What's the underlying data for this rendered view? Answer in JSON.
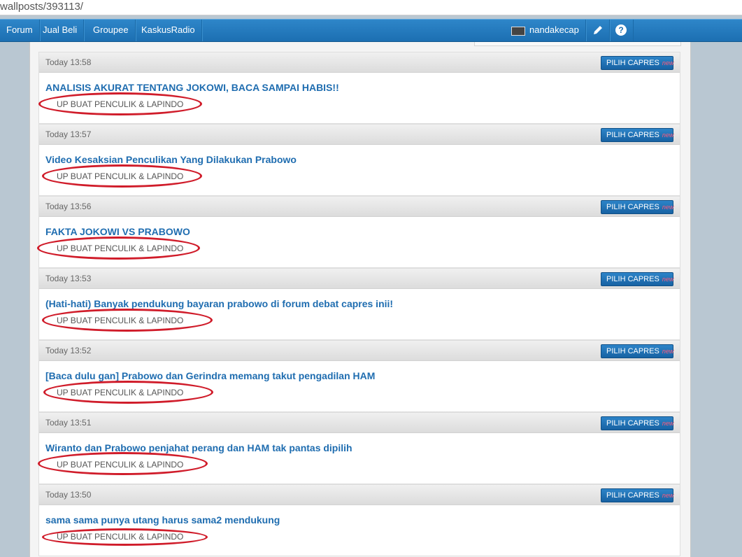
{
  "browser": {
    "url": "wallposts/393113/"
  },
  "nav": {
    "items": [
      "Forum",
      "Jual Beli",
      "Groupee",
      "KaskusRadio"
    ],
    "username": "nandakecap",
    "help_label": "?"
  },
  "posts": [
    {
      "time": "Today 13:58",
      "tag": "PILIH CAPRES",
      "tag_badge": "new",
      "title": "ANALISIS AKURAT TENTANG JOKOWI, BACA SAMPAI HABIS!!",
      "snippet": "UP BUAT PENCULIK & LAPINDO"
    },
    {
      "time": "Today 13:57",
      "tag": "PILIH CAPRES",
      "tag_badge": "new",
      "title": "Video Kesaksian Penculikan Yang Dilakukan Prabowo",
      "snippet": "UP BUAT PENCULIK & LAPINDO"
    },
    {
      "time": "Today 13:56",
      "tag": "PILIH CAPRES",
      "tag_badge": "new",
      "title": "FAKTA JOKOWI VS PRABOWO",
      "snippet": "UP BUAT PENCULIK & LAPINDO"
    },
    {
      "time": "Today 13:53",
      "tag": "PILIH CAPRES",
      "tag_badge": "new",
      "title": "(Hati-hati) Banyak pendukung bayaran prabowo di forum debat capres inii!",
      "snippet": "UP BUAT PENCULIK & LAPINDO"
    },
    {
      "time": "Today 13:52",
      "tag": "PILIH CAPRES",
      "tag_badge": "new",
      "title": "[Baca dulu gan] Prabowo dan Gerindra memang takut pengadilan HAM",
      "snippet": "UP BUAT PENCULIK & LAPINDO"
    },
    {
      "time": "Today 13:51",
      "tag": "PILIH CAPRES",
      "tag_badge": "new",
      "title": "Wiranto dan Prabowo penjahat perang dan HAM tak pantas dipilih",
      "snippet": "UP BUAT PENCULIK & LAPINDO"
    },
    {
      "time": "Today 13:50",
      "tag": "PILIH CAPRES",
      "tag_badge": "new",
      "title": "sama sama punya utang harus sama2 mendukung",
      "snippet": "UP BUAT PENCULIK & LAPINDO"
    }
  ]
}
